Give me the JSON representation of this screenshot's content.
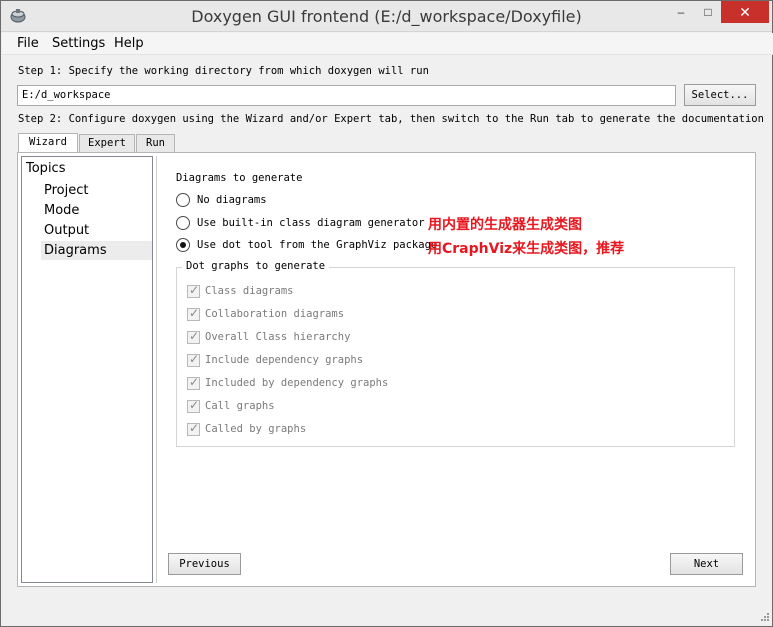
{
  "window": {
    "title": "Doxygen GUI frontend (E:/d_workspace/Doxyfile)",
    "minimize": "–",
    "maximize": "□",
    "close": "✕"
  },
  "menu": [
    "File",
    "Settings",
    "Help"
  ],
  "step1": {
    "label": "Step 1: Specify the working directory from which doxygen will run",
    "dir_value": "E:/d_workspace",
    "select_button": "Select..."
  },
  "step2": {
    "label": "Step 2: Configure doxygen using the Wizard and/or Expert tab, then switch to the Run tab to generate the documentation"
  },
  "tabs": [
    {
      "label": "Wizard",
      "active": true
    },
    {
      "label": "Expert",
      "active": false
    },
    {
      "label": "Run",
      "active": false
    }
  ],
  "topics": {
    "header": "Topics",
    "items": [
      "Project",
      "Mode",
      "Output",
      "Diagrams"
    ],
    "selected": "Diagrams"
  },
  "diagrams": {
    "title": "Diagrams to generate",
    "options": [
      {
        "label": "No diagrams",
        "checked": false
      },
      {
        "label": "Use built-in class diagram generator",
        "checked": false
      },
      {
        "label": "Use dot tool from the GraphViz package",
        "checked": true
      }
    ],
    "annotations": [
      "用内置的生成器生成类图",
      "用CraphViz来生成类图，推荐"
    ],
    "annotation_color": "#e8171f",
    "dot_group_title": "Dot graphs to generate",
    "dot_graphs": [
      {
        "label": "Class diagrams",
        "checked": true
      },
      {
        "label": "Collaboration diagrams",
        "checked": true
      },
      {
        "label": "Overall Class hierarchy",
        "checked": true
      },
      {
        "label": "Include dependency graphs",
        "checked": true
      },
      {
        "label": "Included by dependency graphs",
        "checked": true
      },
      {
        "label": "Call graphs",
        "checked": true
      },
      {
        "label": "Called by graphs",
        "checked": true
      }
    ]
  },
  "nav": {
    "previous": "Previous",
    "next": "Next"
  }
}
